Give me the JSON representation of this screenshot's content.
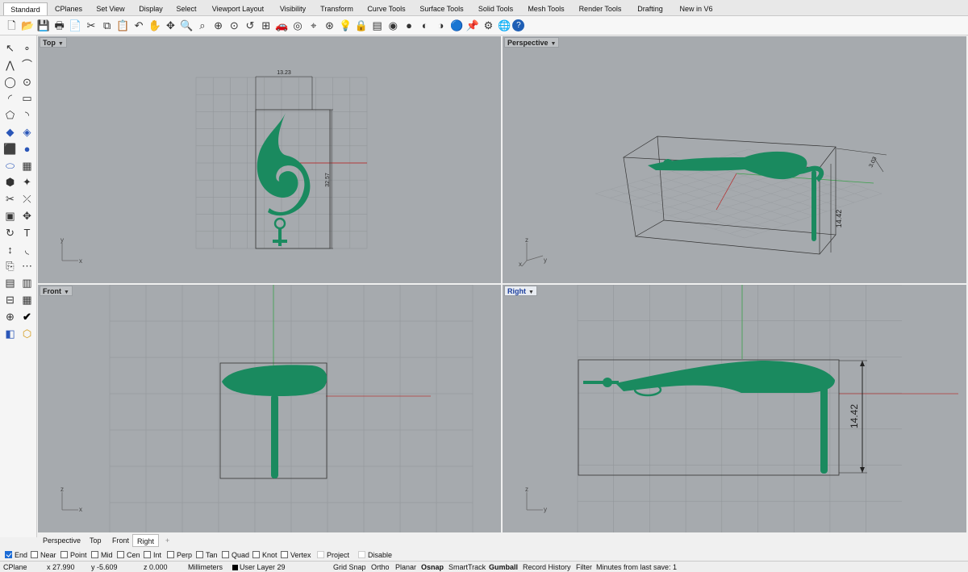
{
  "tabs": [
    "Standard",
    "CPlanes",
    "Set View",
    "Display",
    "Select",
    "Viewport Layout",
    "Visibility",
    "Transform",
    "Curve Tools",
    "Surface Tools",
    "Solid Tools",
    "Mesh Tools",
    "Render Tools",
    "Drafting",
    "New in V6"
  ],
  "active_tab": "Standard",
  "toolbar_icons": [
    "new-file-icon",
    "open-folder-icon",
    "save-icon",
    "print-icon",
    "import-icon",
    "cut-icon",
    "copy-icon",
    "paste-icon",
    "undo-icon",
    "pan-hand-icon",
    "rotate-view-icon",
    "zoom-dynamic-icon",
    "zoom-window-icon",
    "zoom-extents-icon",
    "zoom-selected-icon",
    "undo-view-icon",
    "four-viewports-icon",
    "car-icon",
    "named-views-icon",
    "cplane-icon",
    "set-object-snap-icon",
    "light-bulb-icon",
    "lock-icon",
    "layer-icon",
    "color-wheel-icon",
    "render-sphere-icon",
    "material-sphere-icon",
    "environment-sphere-icon",
    "bluesphere-icon",
    "pin-icon",
    "gears-icon",
    "globe-icon",
    "help-icon"
  ],
  "left_tools": [
    "select-arrow-icon",
    "point-icon",
    "polyline-icon",
    "curve-control-points-icon",
    "circle-icon",
    "ellipse-icon",
    "arc-icon",
    "rectangle-icon",
    "polygon-icon",
    "fillet-curve-icon",
    "surface-corner-icon",
    "surface-loft-icon",
    "box-solid-icon",
    "sphere-solid-icon",
    "cylinder-icon",
    "mesh-icon",
    "boolean-union-icon",
    "explode-icon",
    "split-icon",
    "trim-icon",
    "solid-edit-icon",
    "move-object-icon",
    "rebuild-icon",
    "text-icon",
    "dimension-icon",
    "fillet-edge-icon",
    "offset-icon",
    "array-icon",
    "group-icon",
    "block-icon",
    "layer-off-icon",
    "grid-array-icon",
    "gumball-icon",
    "check-icon",
    "analyze-icon",
    "render-icon"
  ],
  "viewports": {
    "top": {
      "label": "Top",
      "active": false,
      "dim_width": "13.23",
      "dim_height": "32.57"
    },
    "perspective": {
      "label": "Perspective",
      "active": false,
      "dim_height": "14.42",
      "dim_side": "3.03"
    },
    "front": {
      "label": "Front",
      "active": false
    },
    "right": {
      "label": "Right",
      "active": true,
      "dim_height": "14.42"
    }
  },
  "axis_labels": {
    "x": "x",
    "y": "y",
    "z": "z"
  },
  "view_tabs": [
    "Perspective",
    "Top",
    "Front",
    "Right"
  ],
  "view_tab_add": "+",
  "osnaps": [
    {
      "label": "End",
      "checked": true
    },
    {
      "label": "Near",
      "checked": false
    },
    {
      "label": "Point",
      "checked": false
    },
    {
      "label": "Mid",
      "checked": false
    },
    {
      "label": "Cen",
      "checked": false
    },
    {
      "label": "Int",
      "checked": false
    },
    {
      "label": "Perp",
      "checked": false
    },
    {
      "label": "Tan",
      "checked": false
    },
    {
      "label": "Quad",
      "checked": false
    },
    {
      "label": "Knot",
      "checked": false
    },
    {
      "label": "Vertex",
      "checked": false
    },
    {
      "label": "Project",
      "checked": false
    },
    {
      "label": "Disable",
      "checked": false
    }
  ],
  "status": {
    "cplane": "CPlane",
    "x": "x 27.990",
    "y": "y -5.609",
    "z": "z 0.000",
    "units": "Millimeters",
    "layer": "User Layer 29",
    "toggles": [
      "Grid Snap",
      "Ortho",
      "Planar",
      "Osnap",
      "SmartTrack",
      "Gumball",
      "Record History",
      "Filter"
    ],
    "active_toggles": [
      "Osnap",
      "Gumball"
    ],
    "message": "Minutes from last save: 1"
  },
  "colors": {
    "viewport_bg": "#a6aaae",
    "model": "#1a8a5f",
    "grid": "#8f9397",
    "x_axis": "#b33a3a",
    "y_axis": "#3aa04a",
    "active_label": "#1a3d9c"
  }
}
